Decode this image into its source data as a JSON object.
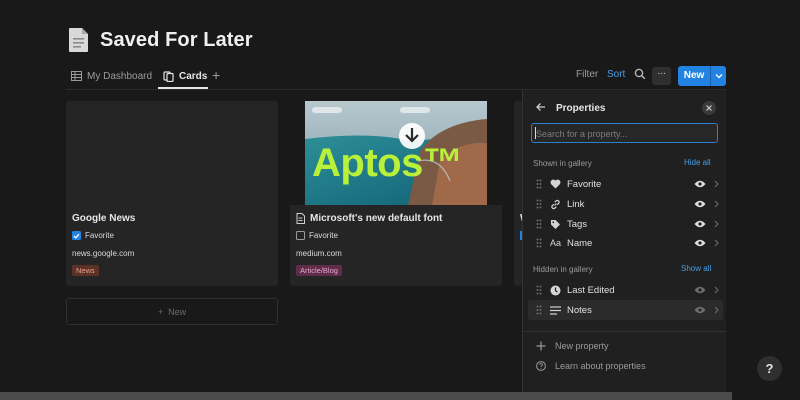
{
  "page": {
    "title": "Saved For Later",
    "icon": "page-icon"
  },
  "views": {
    "tabs": [
      {
        "label": "My Dashboard",
        "icon": "table-icon"
      },
      {
        "label": "Cards",
        "icon": "gallery-icon"
      }
    ],
    "add_label": "+"
  },
  "toolbar": {
    "filter": "Filter",
    "sort": "Sort",
    "more": "···",
    "new": "New"
  },
  "cards": [
    {
      "title": "Google News",
      "checkbox_label": "Favorite",
      "checked": true,
      "url": "news.google.com",
      "tag": "News"
    },
    {
      "title": "Microsoft's new default font",
      "checkbox_label": "Favorite",
      "checked": false,
      "url": "medium.com",
      "tag": "Article/Blog",
      "cover_text": "Aptos™"
    },
    {
      "title": "W"
    }
  ],
  "new_card_label": "New",
  "properties": {
    "title": "Properties",
    "search_placeholder": "Search for a property...",
    "shown_label": "Shown in gallery",
    "hide_all": "Hide all",
    "shown": [
      {
        "name": "Favorite",
        "icon": "heart-icon"
      },
      {
        "name": "Link",
        "icon": "link-icon"
      },
      {
        "name": "Tags",
        "icon": "tag-icon"
      },
      {
        "name": "Name",
        "icon": "text-type-icon",
        "icon_text": "Aa"
      }
    ],
    "hidden_label": "Hidden in gallery",
    "show_all": "Show all",
    "hidden": [
      {
        "name": "Last Edited",
        "icon": "clock-icon"
      },
      {
        "name": "Notes",
        "icon": "lines-icon"
      }
    ],
    "new_property": "New property",
    "learn": "Learn about properties"
  },
  "help": "?",
  "colors": {
    "accent": "#2383e2",
    "news_tag_bg": "#5c3127",
    "article_tag_bg": "#5e2d4a",
    "background": "#191919"
  }
}
